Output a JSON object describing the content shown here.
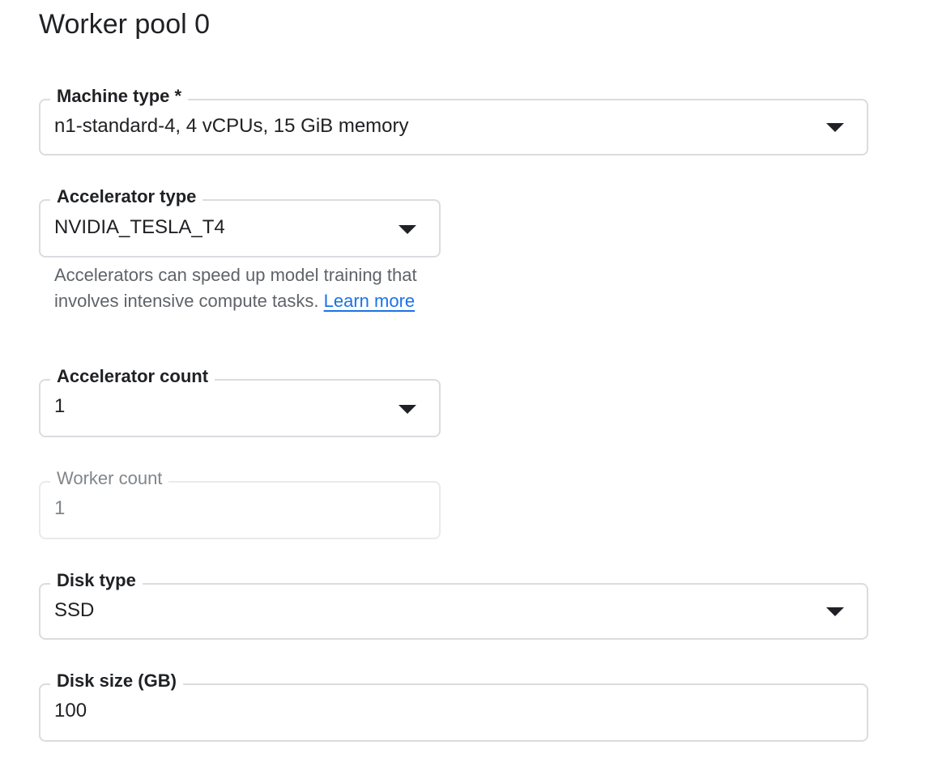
{
  "page": {
    "title": "Worker pool 0"
  },
  "fields": {
    "machine_type": {
      "label": "Machine type *",
      "value": "n1-standard-4, 4 vCPUs, 15 GiB memory"
    },
    "accelerator_type": {
      "label": "Accelerator type",
      "value": "NVIDIA_TESLA_T4",
      "helper_text": "Accelerators can speed up model training that involves intensive compute tasks.",
      "helper_link": "Learn more"
    },
    "accelerator_count": {
      "label": "Accelerator count",
      "value": "1"
    },
    "worker_count": {
      "label": "Worker count",
      "value": "1"
    },
    "disk_type": {
      "label": "Disk type",
      "value": "SSD"
    },
    "disk_size": {
      "label": "Disk size (GB)",
      "value": "100"
    }
  },
  "icons": {
    "dropdown": "arrow-drop-down-icon"
  },
  "colors": {
    "border": "#dadce0",
    "text": "#202124",
    "helper_text": "#5f6368",
    "disabled_text": "#80868b",
    "link": "#1a73e8"
  }
}
